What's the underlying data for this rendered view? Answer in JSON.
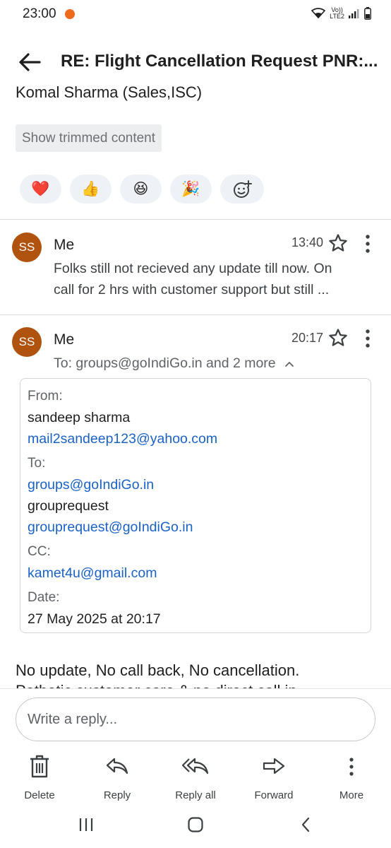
{
  "status_bar": {
    "time": "23:00",
    "lte_top": "Vo))",
    "lte_bottom": "LTE2"
  },
  "header": {
    "subject": "RE: Flight Cancellation Request PNR:..."
  },
  "sender_signature": "Komal Sharma (Sales,ISC)",
  "trim_button": "Show trimmed content",
  "reactions": [
    "❤️",
    "👍",
    "😆",
    "🎉"
  ],
  "message1": {
    "avatar": "SS",
    "sender": "Me",
    "time": "13:40",
    "snippet_line1": "Folks still not recieved any update till now. On",
    "snippet_line2": "call for 2 hrs with customer support but still ..."
  },
  "message2": {
    "avatar": "SS",
    "sender": "Me",
    "time": "20:17",
    "to_summary": "To: groups@goIndiGo.in and 2 more",
    "details": {
      "from_label": "From:",
      "from_name": "sandeep sharma",
      "from_email": "mail2sandeep123@yahoo.com",
      "to_label": "To:",
      "to_email1": "groups@goIndiGo.in",
      "to_name2": "grouprequest",
      "to_email2": "grouprequest@goIndiGo.in",
      "cc_label": "CC:",
      "cc_email": "kamet4u@gmail.com",
      "date_label": "Date:",
      "date_value": "27 May 2025 at 20:17"
    },
    "body_line1": "No update, No call back, No cancellation.",
    "body_line2": "Pathetic customer care & no direct call in"
  },
  "reply": {
    "placeholder": "Write a reply..."
  },
  "actions": {
    "delete": "Delete",
    "reply": "Reply",
    "reply_all": "Reply all",
    "forward": "Forward",
    "more": "More"
  },
  "colors": {
    "avatar": "#b0530f",
    "link": "#1a62c6",
    "status_dot": "#f06a1c"
  }
}
